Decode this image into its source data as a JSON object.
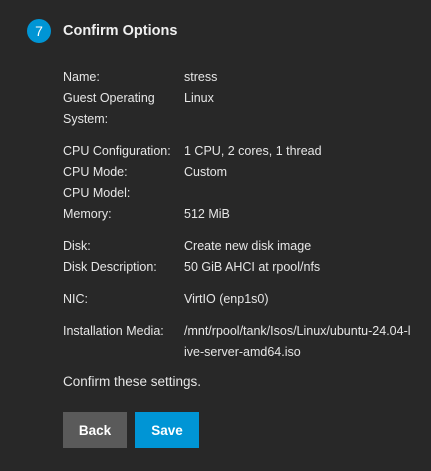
{
  "step": {
    "number": "7",
    "title": "Confirm Options"
  },
  "summary": {
    "name_label": "Name:",
    "name_value": "stress",
    "guest_os_label": "Guest Operating System:",
    "guest_os_value": "Linux",
    "cpu_config_label": "CPU Configuration:",
    "cpu_config_value": "1 CPU, 2 cores, 1 thread",
    "cpu_mode_label": "CPU Mode:",
    "cpu_mode_value": "Custom",
    "cpu_model_label": "CPU Model:",
    "cpu_model_value": "",
    "memory_label": "Memory:",
    "memory_value": "512 MiB",
    "disk_label": "Disk:",
    "disk_value": "Create new disk image",
    "disk_desc_label": "Disk Description:",
    "disk_desc_value": "50 GiB AHCI at rpool/nfs",
    "nic_label": "NIC:",
    "nic_value": "VirtIO (enp1s0)",
    "install_media_label": "Installation Media:",
    "install_media_value": "/mnt/rpool/tank/Isos/Linux/ubuntu-24.04-live-server-amd64.iso"
  },
  "confirm_text": "Confirm these settings.",
  "buttons": {
    "back_label": "Back",
    "save_label": "Save"
  },
  "colors": {
    "accent": "#0095d5",
    "background": "#282828",
    "back_button": "#5a5a5a"
  }
}
